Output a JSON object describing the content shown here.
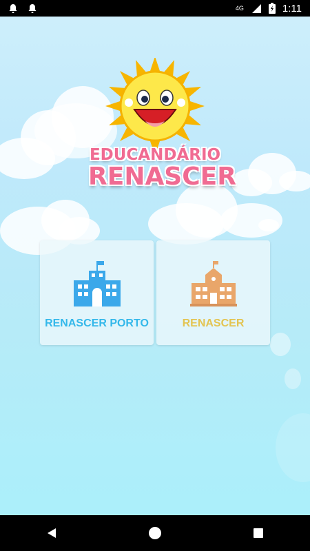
{
  "status_bar": {
    "left_icons": [
      "notification-bell-icon",
      "notification-bell-icon"
    ],
    "network": "4G",
    "time": "1:11"
  },
  "logo": {
    "line1": "EDUCANDÁRIO",
    "line2": "RENASCER"
  },
  "cards": [
    {
      "label": "RENASCER PORTO",
      "icon": "school-building-icon",
      "color": "#34b8ea"
    },
    {
      "label": "RENASCER",
      "icon": "school-building-icon",
      "color": "#e3c451"
    }
  ],
  "nav": {
    "buttons": [
      "back-icon",
      "home-icon",
      "recents-icon"
    ]
  }
}
